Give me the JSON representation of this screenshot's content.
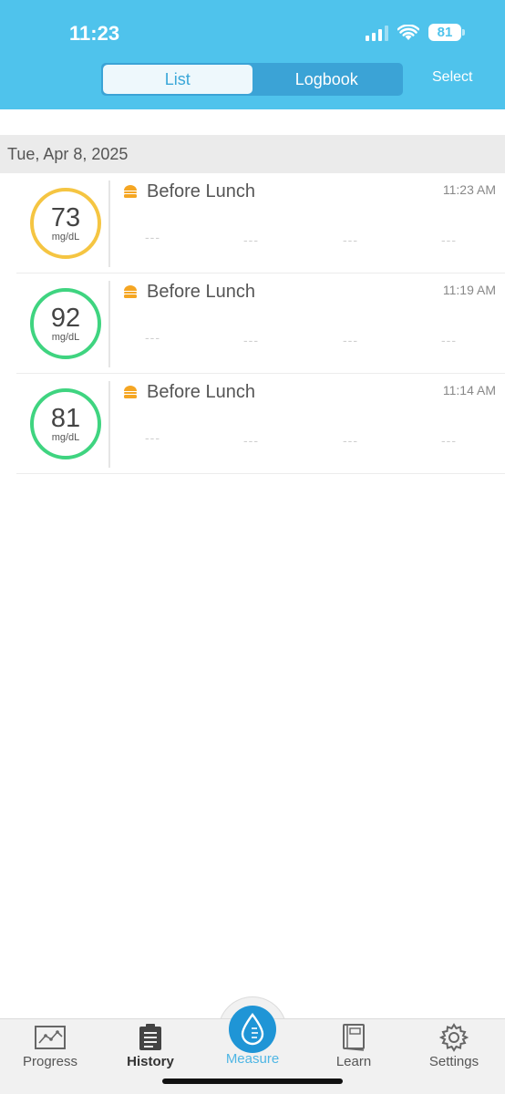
{
  "status_bar": {
    "time": "11:23",
    "battery": "81"
  },
  "header": {
    "segments": [
      {
        "label": "List",
        "active": true
      },
      {
        "label": "Logbook",
        "active": false
      }
    ],
    "select_label": "Select"
  },
  "date_header": "Tue, Apr 8, 2025",
  "readings": [
    {
      "value": "73",
      "unit": "mg/dL",
      "meal": "Before Lunch",
      "time": "11:23 AM",
      "ring_color": "#f5c542",
      "dashes": [
        "---",
        "---",
        "---",
        "---"
      ]
    },
    {
      "value": "92",
      "unit": "mg/dL",
      "meal": "Before Lunch",
      "time": "11:19 AM",
      "ring_color": "#3fd480",
      "dashes": [
        "---",
        "---",
        "---",
        "---"
      ]
    },
    {
      "value": "81",
      "unit": "mg/dL",
      "meal": "Before Lunch",
      "time": "11:14 AM",
      "ring_color": "#3fd480",
      "dashes": [
        "---",
        "---",
        "---",
        "---"
      ]
    }
  ],
  "tabbar": {
    "items": [
      {
        "label": "Progress",
        "icon": "chart-icon"
      },
      {
        "label": "History",
        "icon": "clipboard-icon"
      },
      {
        "label": "Measure",
        "icon": "drop-icon"
      },
      {
        "label": "Learn",
        "icon": "book-icon"
      },
      {
        "label": "Settings",
        "icon": "gear-icon"
      }
    ]
  },
  "colors": {
    "header_bg": "#4fc3ec",
    "accent": "#1f95d6",
    "meal_icon": "#f5a623"
  }
}
